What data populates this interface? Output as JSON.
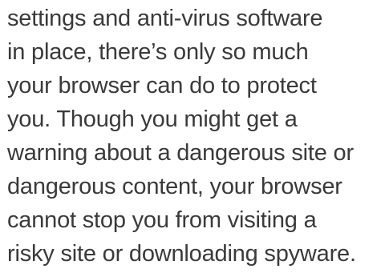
{
  "article": {
    "lines": [
      "settings and anti-virus software",
      "in place, there’s only so much",
      "your browser can do to protect",
      "you. Though you might get a",
      "warning about a dangerous site or",
      "dangerous content, your browser",
      "cannot stop you from visiting a",
      "risky site or downloading spyware."
    ]
  },
  "colors": {
    "text": "#3a3a3a",
    "background": "#ffffff"
  }
}
